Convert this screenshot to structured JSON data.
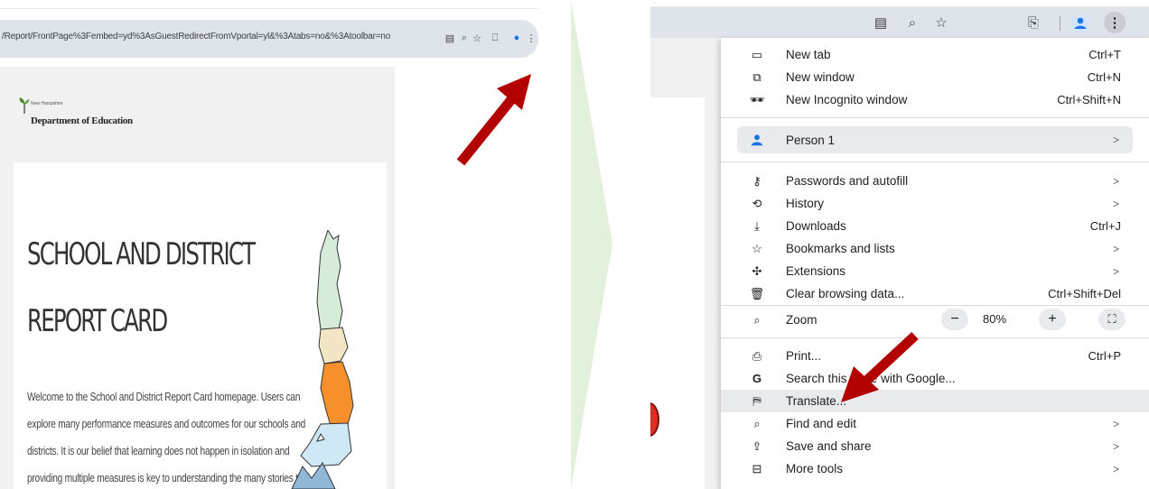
{
  "left": {
    "url": "/Report/FrontPage%3Fembed=yd%3AsGuestRedirectFromVportal=yl&%3Atabs=no&%3Atoolbar=no",
    "org_small": "New Hampshire",
    "org_name": "Department of Education",
    "heading_line1": "SCHOOL AND DISTRICT",
    "heading_line2": "REPORT CARD",
    "body_lines": [
      "Welcome to the School and District Report Card homepage. Users can",
      "explore many performance measures and outcomes for our schools and",
      "districts. It is our belief that learning does not happen in isolation and",
      "providing multiple measures is key to understanding the many stories told"
    ]
  },
  "menu": {
    "items": [
      {
        "icon": "new-tab-icon",
        "glyph": "▭",
        "label": "New tab",
        "shortcut": "Ctrl+T"
      },
      {
        "icon": "new-window-icon",
        "glyph": "⧉",
        "label": "New window",
        "shortcut": "Ctrl+N"
      },
      {
        "icon": "incognito-icon",
        "glyph": "🕶",
        "label": "New Incognito window",
        "shortcut": "Ctrl+Shift+N"
      }
    ],
    "person": {
      "icon": "person-icon",
      "label": "Person 1",
      "arrow": ">"
    },
    "items2": [
      {
        "icon": "key-icon",
        "glyph": "⚷",
        "label": "Passwords and autofill",
        "arrow": ">"
      },
      {
        "icon": "history-icon",
        "glyph": "⟲",
        "label": "History",
        "arrow": ">"
      },
      {
        "icon": "download-icon",
        "glyph": "⤓",
        "label": "Downloads",
        "shortcut": "Ctrl+J"
      },
      {
        "icon": "star-icon",
        "glyph": "☆",
        "label": "Bookmarks and lists",
        "arrow": ">"
      },
      {
        "icon": "extensions-icon",
        "glyph": "✣",
        "label": "Extensions",
        "arrow": ">"
      },
      {
        "icon": "trash-icon",
        "glyph": "🗑",
        "label": "Clear browsing data...",
        "shortcut": "Ctrl+Shift+Del"
      }
    ],
    "zoom": {
      "label": "Zoom",
      "minus": "−",
      "value": "80%",
      "plus": "+",
      "fullscreen": "⛶"
    },
    "items3": [
      {
        "icon": "print-icon",
        "glyph": "⎙",
        "label": "Print...",
        "shortcut": "Ctrl+P"
      },
      {
        "icon": "google-icon",
        "glyph": "G",
        "label": "Search this page with Google..."
      },
      {
        "icon": "translate-icon",
        "glyph": "⛿",
        "label": "Translate...",
        "highlighted": true
      },
      {
        "icon": "find-icon",
        "glyph": "⌕",
        "label": "Find and edit",
        "arrow": ">"
      },
      {
        "icon": "share-icon",
        "glyph": "⇪",
        "label": "Save and share",
        "arrow": ">"
      },
      {
        "icon": "toolbox-icon",
        "glyph": "⊟",
        "label": "More tools",
        "arrow": ">"
      }
    ]
  },
  "colors": {
    "arrow": "#b30000",
    "chevron": "#e3f1dc",
    "menu_highlight": "#e8eaed",
    "accent": "#1a73e8"
  }
}
